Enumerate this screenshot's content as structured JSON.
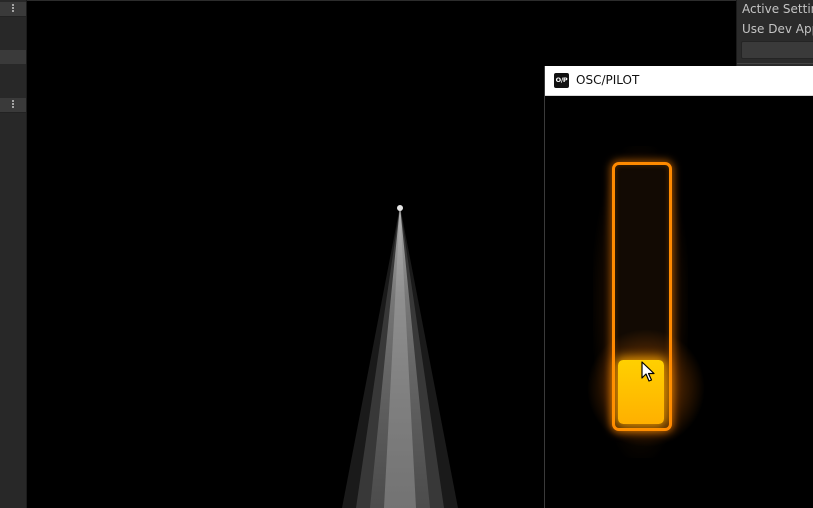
{
  "window": {
    "title": "OSC/PILOT",
    "logo_text": "O/P"
  },
  "inspector": {
    "active_settings_label": "Active Settin",
    "use_dev_app_label": "Use Dev App"
  },
  "fader": {
    "value": 0.0,
    "track_color": "#ff8a00",
    "handle_color": "#ffc400"
  },
  "icons": {
    "panel_menu": "kebab-menu-icon",
    "cursor": "mouse-pointer-icon",
    "logo": "osc-pilot-logo-icon"
  },
  "colors": {
    "accent": "#ff8a00",
    "titlebar": "#ffffff",
    "editor_bg": "#282828"
  }
}
